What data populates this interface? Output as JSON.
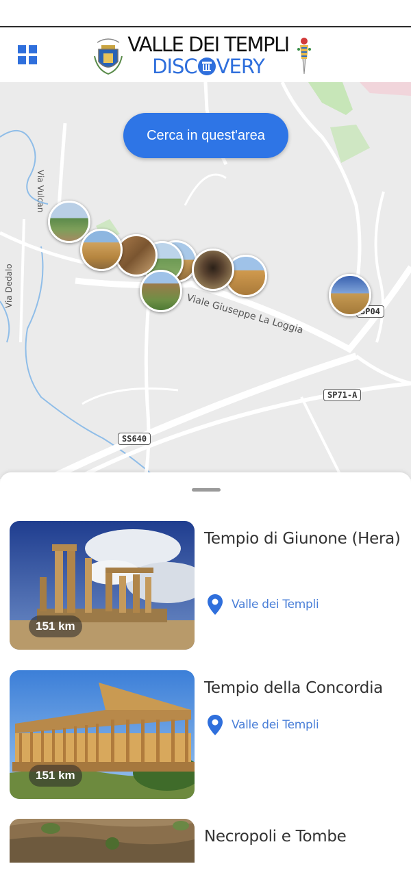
{
  "header": {
    "logo_line1": "VALLE DEI TEMPLI",
    "logo_line2_left": "DISC",
    "logo_line2_right": "VERY",
    "accent_color": "#2f6fdc"
  },
  "map": {
    "search_button_label": "Cerca in quest'area",
    "street_labels": {
      "via_vulcano": "Via Vulcan",
      "via_dedalo": "Via Dedalo",
      "viale_la_loggia": "Viale Giuseppe La Loggia"
    },
    "road_badges": {
      "sp04": "SP04",
      "sp71a": "SP71-A",
      "ss640": "SS640"
    },
    "pin_count": 9
  },
  "list": {
    "items": [
      {
        "title": "Tempio di Giunone (Hera)",
        "distance": "151 km",
        "location": "Valle dei Templi"
      },
      {
        "title": "Tempio della Concordia",
        "distance": "151 km",
        "location": "Valle dei Templi"
      },
      {
        "title": "Necropoli e Tombe"
      }
    ]
  },
  "colors": {
    "primary_button": "#2e75e6",
    "link_blue": "#4a7fd8",
    "map_background": "#ebebeb"
  }
}
